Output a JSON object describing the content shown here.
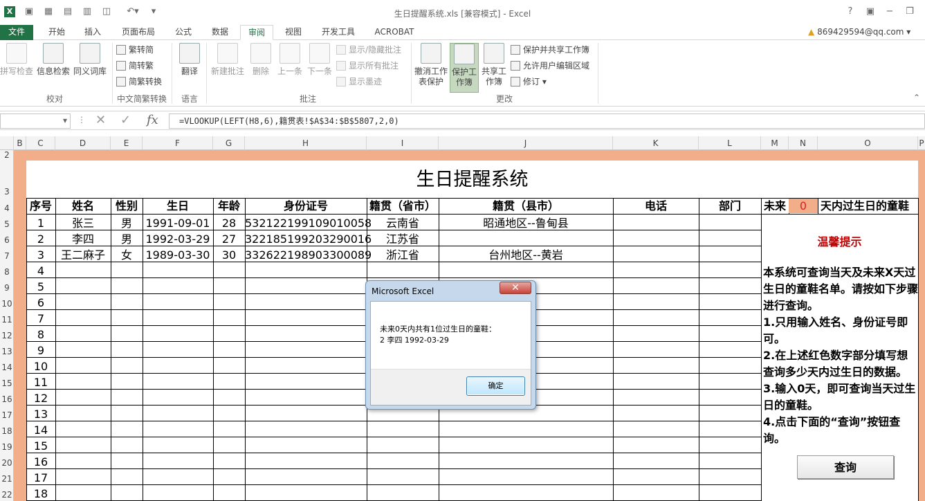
{
  "window": {
    "title": "生日提醒系统.xls  [兼容模式] - Excel",
    "account": "869429594@qq.com",
    "help": "?"
  },
  "tabs": [
    "文件",
    "开始",
    "插入",
    "页面布局",
    "公式",
    "数据",
    "审阅",
    "视图",
    "开发工具",
    "ACROBAT"
  ],
  "ribbon": {
    "proofing": {
      "spell": "拼写检查",
      "research": "信息检索",
      "thesaurus": "同义词库",
      "label": "校对"
    },
    "chinese": {
      "t2s": "繁转简",
      "s2t": "简转繁",
      "convert": "简繁转换",
      "label": "中文简繁转换"
    },
    "language": {
      "translate": "翻译",
      "label": "语言"
    },
    "comments": {
      "new": "新建批注",
      "delete": "删除",
      "prev": "上一条",
      "next": "下一条",
      "show_hide": "显示/隐藏批注",
      "show_all": "显示所有批注",
      "show_ink": "显示墨迹",
      "label": "批注"
    },
    "changes": {
      "unprotect": "撤消工作表保护",
      "protect": "保护工作簿",
      "share": "共享工作簿",
      "protect_share": "保护并共享工作簿",
      "allow_edit": "允许用户编辑区域",
      "track": "修订",
      "label": "更改"
    }
  },
  "formula_bar": {
    "name_box": "",
    "formula": "=VLOOKUP(LEFT(H8,6),籍贯表!$A$34:$B$5807,2,0)"
  },
  "columns": [
    "B",
    "C",
    "D",
    "E",
    "F",
    "G",
    "H",
    "I",
    "J",
    "K",
    "L",
    "M",
    "N",
    "O",
    "P"
  ],
  "rows": [
    "2",
    "3",
    "4",
    "5",
    "6",
    "7",
    "8",
    "9",
    "10",
    "11",
    "12",
    "13",
    "14",
    "15",
    "16",
    "17",
    "18",
    "19",
    "20",
    "21",
    "22"
  ],
  "sheet": {
    "title": "生日提醒系统",
    "headers": {
      "no": "序号",
      "name": "姓名",
      "gender": "性别",
      "birthday": "生日",
      "age": "年龄",
      "id": "身份证号",
      "province": "籍贯（省市）",
      "county": "籍贯（县市）",
      "phone": "电话",
      "dept": "部门"
    },
    "records": [
      {
        "no": "1",
        "name": "张三",
        "gender": "男",
        "birthday": "1991-09-01",
        "age": "28",
        "id": "532122199109010058",
        "province": "云南省",
        "county": "昭通地区--鲁甸县"
      },
      {
        "no": "2",
        "name": "李四",
        "gender": "男",
        "birthday": "1992-03-29",
        "age": "27",
        "id": "322185199203290016",
        "province": "江苏省",
        "county": ""
      },
      {
        "no": "3",
        "name": "王二麻子",
        "gender": "女",
        "birthday": "1989-03-30",
        "age": "30",
        "id": "332622198903300089",
        "province": "浙江省",
        "county": "台州地区--黄岩"
      }
    ],
    "empty_numbers": [
      "4",
      "5",
      "6",
      "7",
      "8",
      "9",
      "10",
      "11",
      "12",
      "13",
      "14",
      "15",
      "16",
      "17",
      "18"
    ],
    "future_label": "未来",
    "future_days": "0",
    "future_suffix": "天内过生日的童鞋",
    "tip_title": "温馨提示",
    "tip_lines": [
      "本系统可查询当天及未来X天过生日的童鞋名单。请按如下步骤进行查询。",
      "1.只用输入姓名、身份证号即可。",
      "2.在上述红色数字部分填写想查询多少天内过生日的数据。",
      "3.输入0天，即可查询当天过生日的童鞋。",
      "4.点击下面的“查询”按钮查询。"
    ],
    "query_button": "查询"
  },
  "dialog": {
    "title": "Microsoft Excel",
    "close": "✕",
    "line1": "未来0天内共有1位过生日的童鞋：",
    "line2": "2 李四 1992-03-29",
    "ok": "确定"
  }
}
